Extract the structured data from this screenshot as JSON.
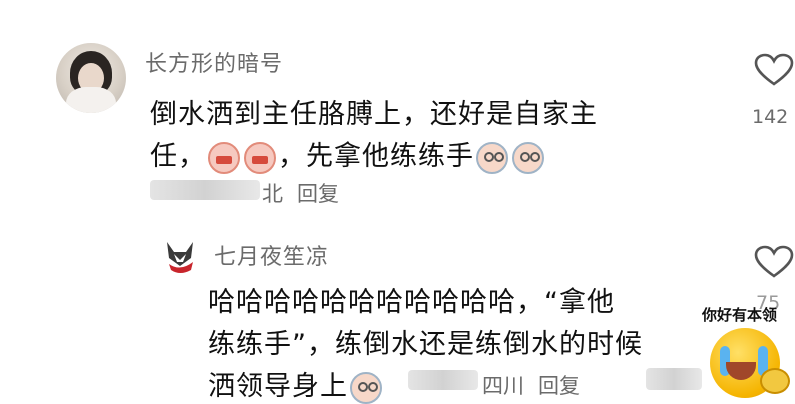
{
  "comment1": {
    "username": "长方形的暗号",
    "text_line1": "倒水洒到主任胳膊上，还好是自家主",
    "text_line2_start": "任，",
    "text_line2_mid": "，先拿他练练手",
    "location": "北",
    "reply_label": "回复",
    "like_count": "142"
  },
  "comment2": {
    "username": "七月夜笙凉",
    "text_line1": "哈哈哈哈哈哈哈哈哈哈哈，“拿他",
    "text_line2": "练练手”，练倒水还是练倒水的时候",
    "text_line3": "洒领导身上",
    "location": "四川",
    "reply_label": "回复",
    "like_count": "75"
  },
  "sticker": {
    "caption": "你好有本领"
  }
}
